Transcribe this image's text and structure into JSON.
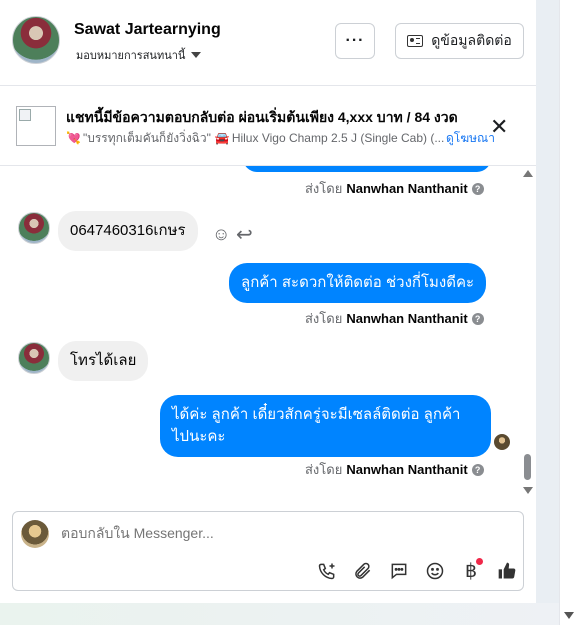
{
  "header": {
    "name": "Sawat Jartearnying",
    "assignee": "มอบหมายการสนทนานี้",
    "more_label": "···",
    "contact_label": "ดูข้อมูลติดต่อ"
  },
  "ad": {
    "title": "แชทนี้มีข้อความตอบกลับต่อ ผ่อนเริ่มต้นเพียง 4,xxx บาท / 84 งวด",
    "subtitle": "\"บรรทุกเต็มคันก็ยังวิ่งฉิว\"",
    "model": "Hilux Vigo Champ 2.5 J (Single Cab) (...",
    "link": "ดูโฆษณา",
    "close": "✕"
  },
  "messages": [
    {
      "type": "sent_by",
      "prefix": "ส่งโดย",
      "agent": "Nanwhan Nanthanit"
    },
    {
      "type": "in",
      "text": "0647460316เกษร"
    },
    {
      "type": "out",
      "text": "ลูกค้า  สะดวกให้ติดต่อ ช่วงกี่โมงดีคะ"
    },
    {
      "type": "sent_by",
      "prefix": "ส่งโดย",
      "agent": "Nanwhan Nanthanit"
    },
    {
      "type": "in",
      "text": "โทรได้เลย"
    },
    {
      "type": "out",
      "line1": "ได้ค่ะ ลูกค้า  เดี๋ยวสักครู่จะมีเซลล์ติดต่อ ลูกค้า",
      "line2": "ไปนะคะ"
    },
    {
      "type": "sent_by",
      "prefix": "ส่งโดย",
      "agent": "Nanwhan Nanthanit"
    }
  ],
  "info_glyph": "?",
  "composer": {
    "placeholder": "ตอบกลับใน Messenger...",
    "tools": [
      "phone-plus-icon",
      "paperclip-icon",
      "saved-reply-icon",
      "emoji-icon",
      "baht-payment-icon",
      "thumbs-up-icon"
    ]
  }
}
